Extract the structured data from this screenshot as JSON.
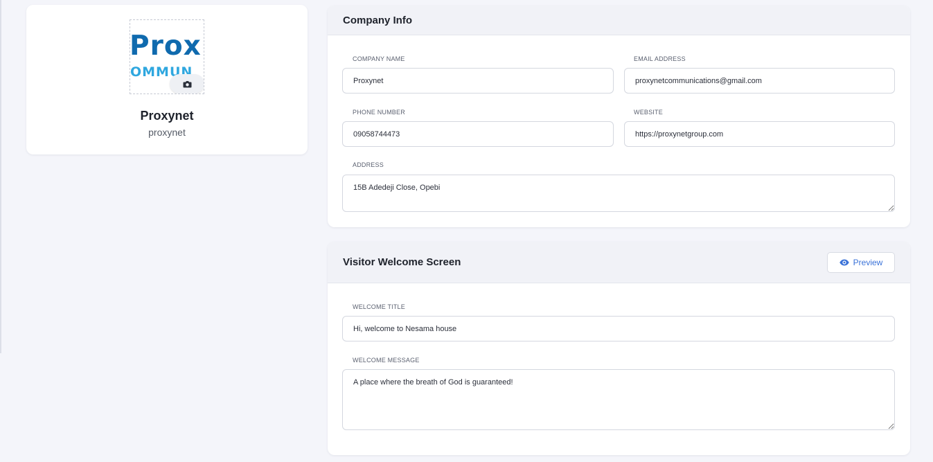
{
  "profile": {
    "logo_text": "Prox",
    "logo_subtext": "OMMUN",
    "name": "Proxynet",
    "handle": "proxynet"
  },
  "company_info": {
    "title": "Company Info",
    "company_name_label": "COMPANY NAME",
    "company_name_value": "Proxynet",
    "email_label": "EMAIL ADDRESS",
    "email_value": "proxynetcommunications@gmail.com",
    "phone_label": "PHONE NUMBER",
    "phone_value": "09058744473",
    "website_label": "WEBSITE",
    "website_value": "https://proxynetgroup.com",
    "address_label": "ADDRESS",
    "address_value": "15B Adedeji Close, Opebi"
  },
  "welcome_screen": {
    "title": "Visitor Welcome Screen",
    "preview_label": "Preview",
    "welcome_title_label": "WELCOME TITLE",
    "welcome_title_value": "Hi, welcome to Nesama house",
    "welcome_message_label": "WELCOME MESSAGE",
    "welcome_message_value": "A place where the breath of God is guaranteed!"
  },
  "colors": {
    "accent": "#3a72d8",
    "logo_dark": "#0f6aae",
    "logo_light": "#2fa7df",
    "page_bg": "#f4f5fa",
    "card_header_bg": "#f1f2f7"
  },
  "icons": {
    "camera": "camera-icon",
    "preview": "eye-icon"
  }
}
